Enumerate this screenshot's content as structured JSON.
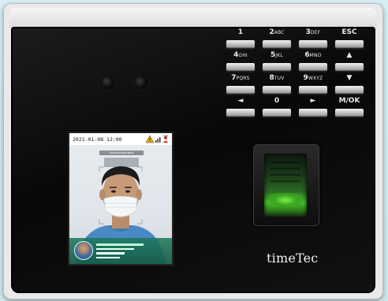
{
  "keypad": {
    "rows": [
      [
        {
          "main": "1",
          "sub": ""
        },
        {
          "main": "2",
          "sub": "ABC"
        },
        {
          "main": "3",
          "sub": "DEF"
        },
        {
          "main": "ESC",
          "sub": ""
        }
      ],
      [
        {
          "main": "4",
          "sub": "GHI"
        },
        {
          "main": "5",
          "sub": "JKL"
        },
        {
          "main": "6",
          "sub": "MNO"
        },
        {
          "main": "▲",
          "sub": ""
        }
      ],
      [
        {
          "main": "7",
          "sub": "PQRS"
        },
        {
          "main": "8",
          "sub": "TUV"
        },
        {
          "main": "9",
          "sub": "WXYZ"
        },
        {
          "main": "▼",
          "sub": ""
        }
      ],
      [
        {
          "main": "◄",
          "sub": ""
        },
        {
          "main": "0",
          "sub": ""
        },
        {
          "main": "►",
          "sub": ""
        },
        {
          "main": "M/OK",
          "sub": ""
        }
      ]
    ]
  },
  "screen": {
    "datetime": "2021-01-08 12:00",
    "status_icons": [
      "warning-icon",
      "signal-icon",
      "user-icon"
    ],
    "banner": "Normal temperature"
  },
  "brand": "timeTec",
  "colors": {
    "panel": "#0a0a0a",
    "key": "#c9c9c9",
    "sensor_glow": "#46c62e"
  }
}
